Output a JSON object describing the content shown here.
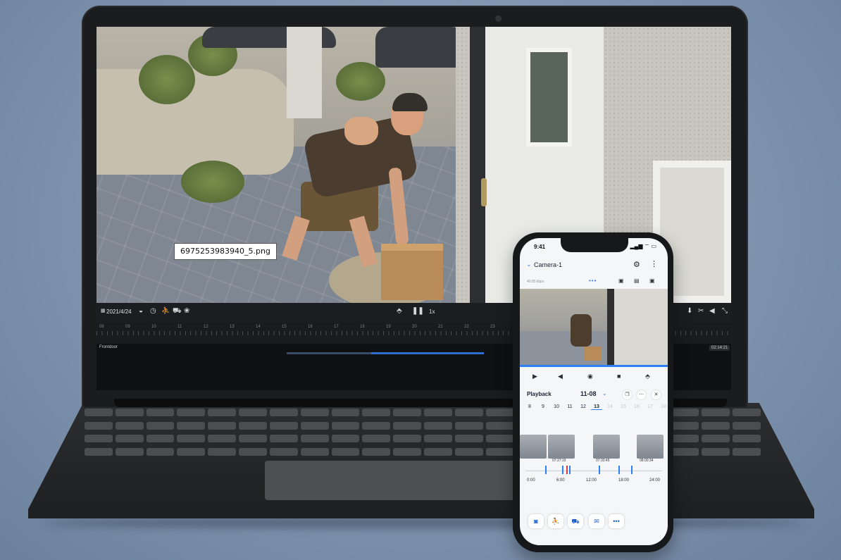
{
  "desktop": {
    "filename": "6975253983940_5.png",
    "date": "2021/4/24",
    "speed": "1x",
    "track_label": "Frontdoor",
    "time_badge": "02:14:21",
    "tick_labels": [
      "08",
      "09",
      "10",
      "11",
      "12",
      "13",
      "14",
      "15",
      "16",
      "17",
      "18",
      "19",
      "20",
      "21",
      "22",
      "23"
    ],
    "icons": {
      "calendar": "calendar-icon",
      "filter": "filter-icon",
      "clock": "clock-icon",
      "person": "person-icon",
      "car": "car-icon",
      "pet": "pet-icon",
      "clip": "clip-icon",
      "pause": "pause-icon",
      "download": "download-icon",
      "cut": "scissors-icon",
      "volume": "volume-icon",
      "fullscreen": "fullscreen-icon"
    }
  },
  "phone": {
    "status_time": "9:41",
    "status_icons": "▂▄▆ ⌔ ▭",
    "camera_name": "Camera-1",
    "bitrate": "40.85 kbps",
    "playback_label": "Playback",
    "playback_date": "11-08",
    "days": [
      "8",
      "9",
      "10",
      "11",
      "12",
      "13",
      "14",
      "15",
      "16",
      "17",
      "18"
    ],
    "active_day": "13",
    "thumb_times": [
      "07:27:19",
      "07:33:45",
      "08:00:34"
    ],
    "hour_labels": [
      "0:00",
      "6:00",
      "12:00",
      "18:00",
      "24:00"
    ],
    "accent": "#2d7ff9"
  }
}
